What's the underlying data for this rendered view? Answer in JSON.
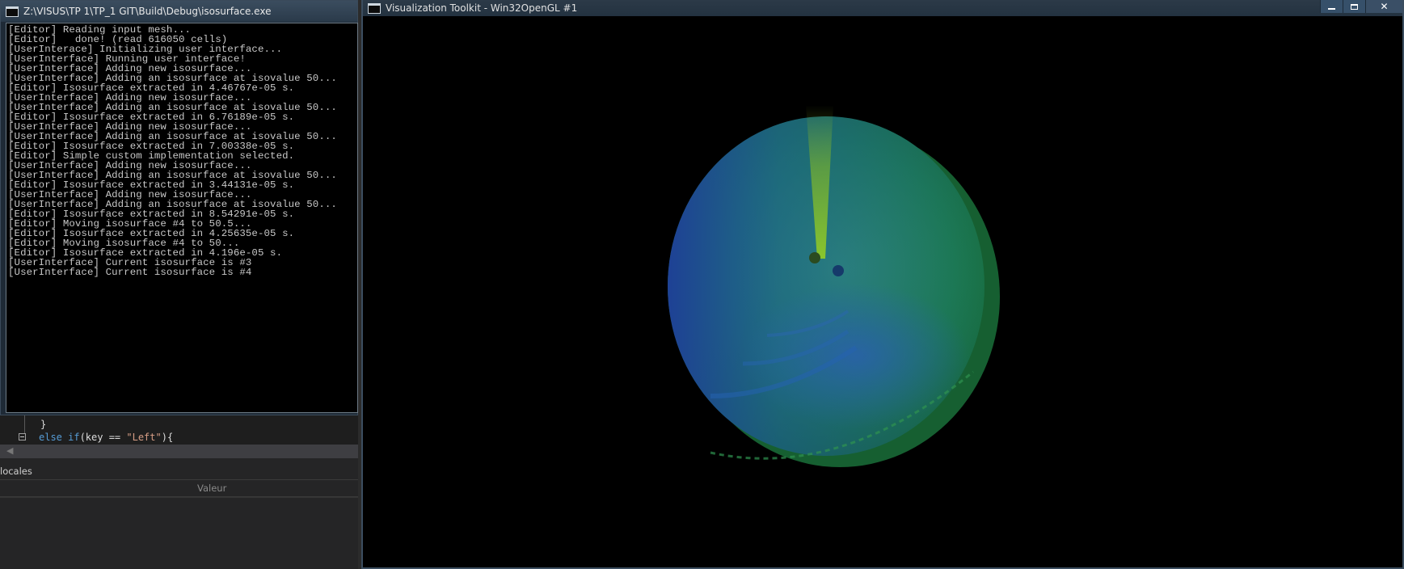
{
  "console": {
    "title": "Z:\\VISUS\\TP 1\\TP_1 GIT\\Build\\Debug\\isosurface.exe",
    "lines": [
      "[Editor] Reading input mesh...",
      "[Editor]   done! (read 616050 cells)",
      "[UserInterace] Initializing user interface...",
      "[UserInterface] Running user interface!",
      "[UserInterface] Adding new isosurface...",
      "[UserInterface] Adding an isosurface at isovalue 50...",
      "[Editor] Isosurface extracted in 4.46767e-05 s.",
      "[UserInterface] Adding new isosurface...",
      "[UserInterface] Adding an isosurface at isovalue 50...",
      "[Editor] Isosurface extracted in 6.76189e-05 s.",
      "[UserInterface] Adding new isosurface...",
      "[UserInterface] Adding an isosurface at isovalue 50...",
      "[Editor] Isosurface extracted in 7.00338e-05 s.",
      "[Editor] Simple custom implementation selected.",
      "[UserInterface] Adding new isosurface...",
      "[UserInterface] Adding an isosurface at isovalue 50...",
      "[Editor] Isosurface extracted in 3.44131e-05 s.",
      "[UserInterface] Adding new isosurface...",
      "[UserInterface] Adding an isosurface at isovalue 50...",
      "[Editor] Isosurface extracted in 8.54291e-05 s.",
      "[Editor] Moving isosurface #4 to 50.5...",
      "[Editor] Isosurface extracted in 4.25635e-05 s.",
      "[Editor] Moving isosurface #4 to 50...",
      "[Editor] Isosurface extracted in 4.196e-05 s.",
      "[UserInterface] Current isosurface is #3",
      "[UserInterface] Current isosurface is #4"
    ]
  },
  "ide": {
    "code_line_1": "}",
    "code_keyword": "else if",
    "code_open": "(key == ",
    "code_string": "\"Left\"",
    "code_close": "){",
    "locals_title": "locales",
    "value_column": "Valeur"
  },
  "vtk": {
    "title": "Visualization Toolkit - Win32OpenGL #1"
  },
  "colors": {
    "background": "#000000",
    "surface_green": "#1f8a4a",
    "surface_blue": "#1f4fa0",
    "surface_yellow": "#9ab81e"
  },
  "icons": [
    "console-app-icon",
    "vtk-app-icon",
    "minimize-icon",
    "maximize-icon",
    "close-icon",
    "fold-collapse-icon",
    "scroll-left-arrow-icon"
  ]
}
